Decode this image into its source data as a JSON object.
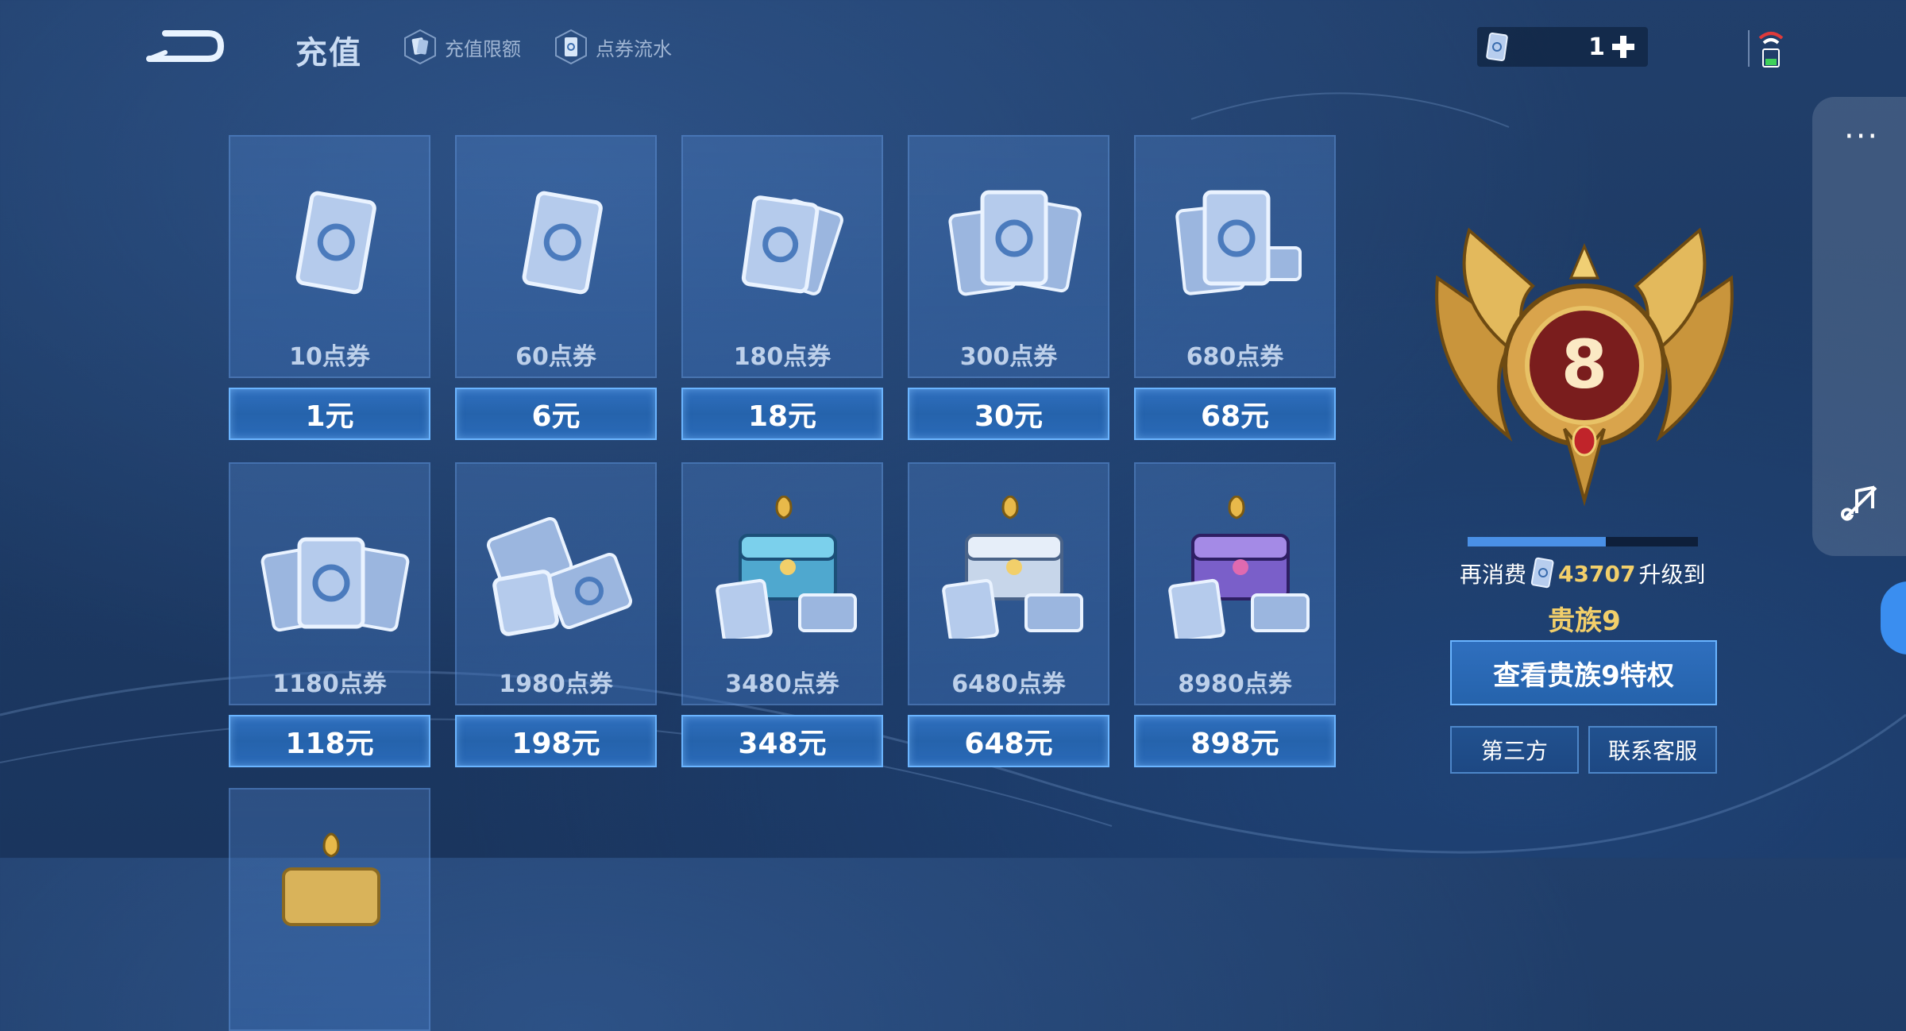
{
  "header": {
    "title": "充值",
    "links": [
      {
        "label": "充值限额",
        "icon": "card-hex-icon"
      },
      {
        "label": "点券流水",
        "icon": "ticket-hex-icon"
      }
    ],
    "currency": {
      "count": "1",
      "icon": "coupon-icon"
    }
  },
  "packages": [
    {
      "label": "10点券",
      "price": "1元"
    },
    {
      "label": "60点券",
      "price": "6元"
    },
    {
      "label": "180点券",
      "price": "18元"
    },
    {
      "label": "300点券",
      "price": "30元"
    },
    {
      "label": "680点券",
      "price": "68元"
    },
    {
      "label": "1180点券",
      "price": "118元"
    },
    {
      "label": "1980点券",
      "price": "198元"
    },
    {
      "label": "3480点券",
      "price": "348元"
    },
    {
      "label": "6480点券",
      "price": "648元"
    },
    {
      "label": "8980点券",
      "price": "898元"
    }
  ],
  "noble": {
    "level": "8",
    "progress_fraction": 0.6,
    "prefix": "再消费",
    "amount": "43707",
    "suffix": "升级到",
    "next_level": "贵族9",
    "privilege_button": "查看贵族9特权",
    "third_party_button": "第三方",
    "service_button": "联系客服"
  },
  "colors": {
    "gold": "#f2cf6a",
    "button_blue": "#2f6fbe",
    "button_border": "#6ab4ff",
    "background": "#1d3a64"
  }
}
